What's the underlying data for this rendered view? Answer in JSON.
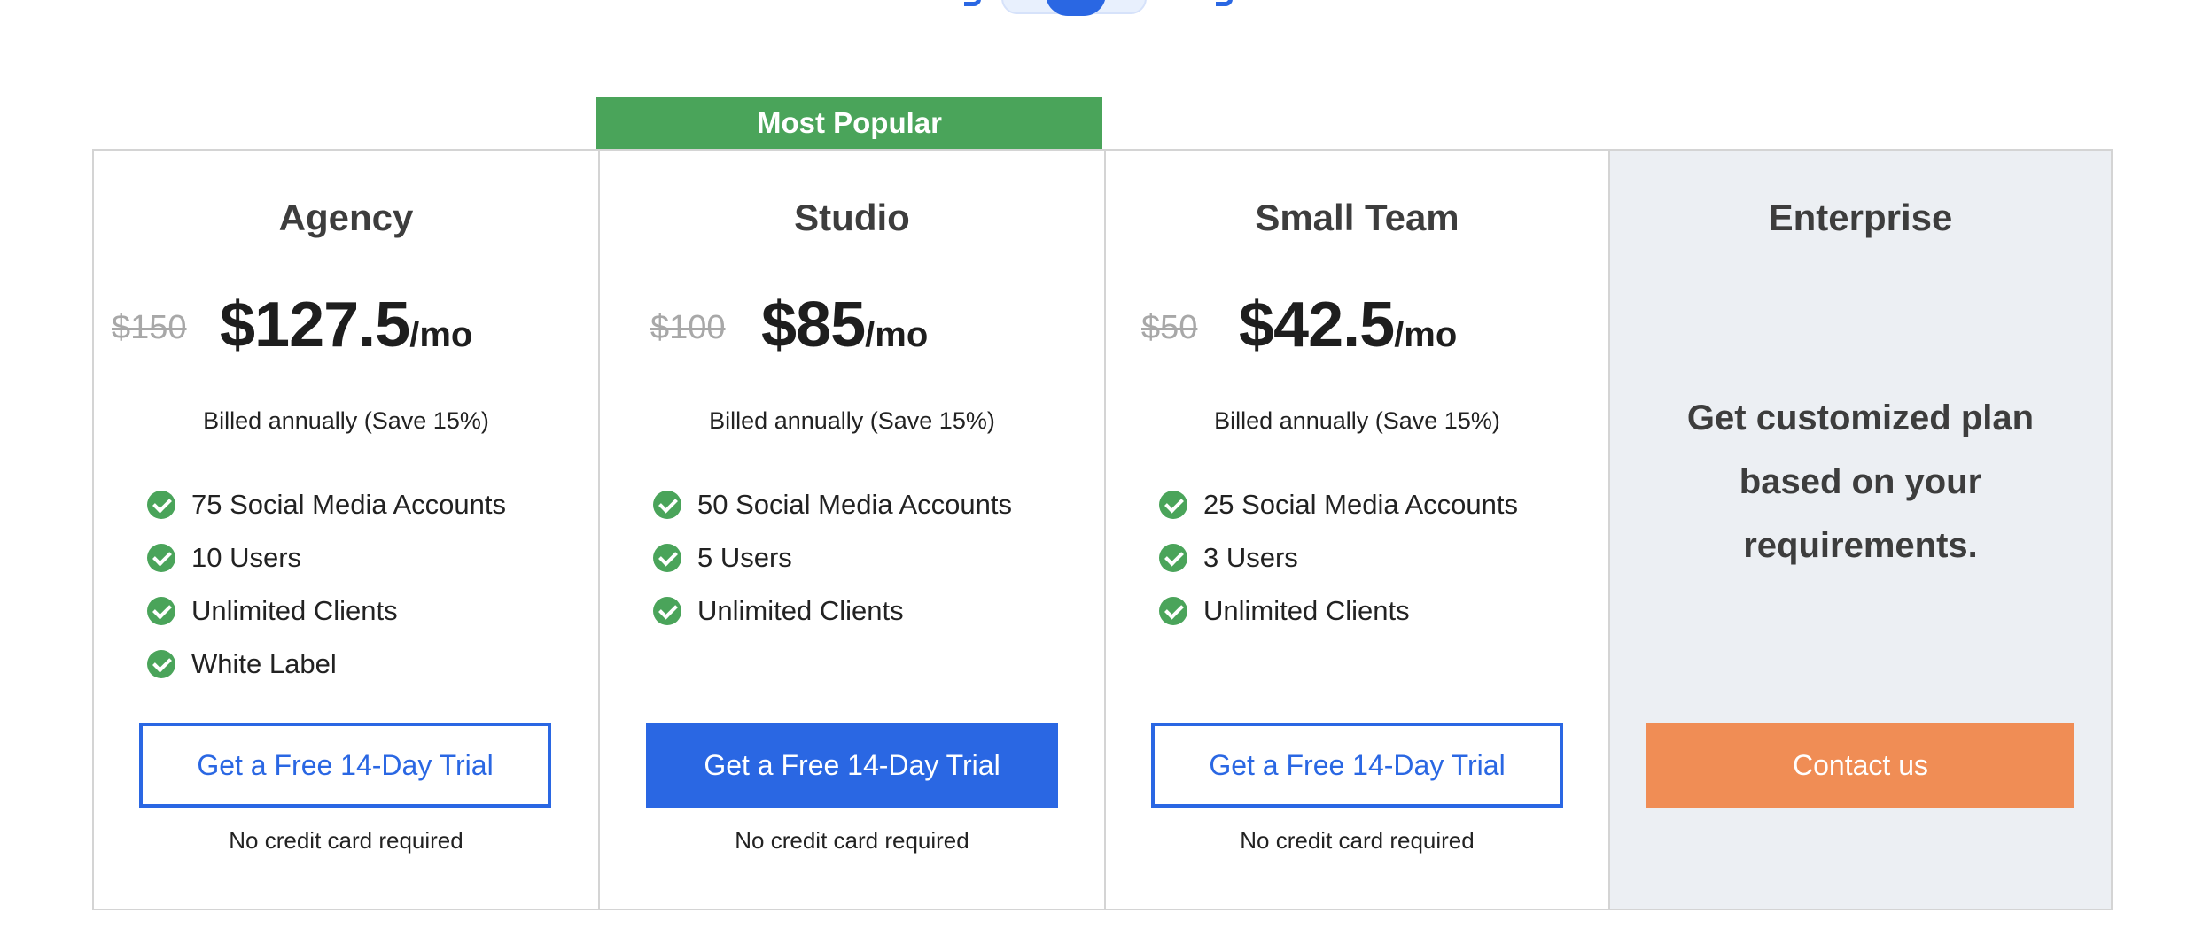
{
  "toggle": {
    "state": "annual"
  },
  "popular_banner": "Most Popular",
  "plans": [
    {
      "name": "Agency",
      "old_price": "$150",
      "price": "$127.5",
      "per": "/mo",
      "billing": "Billed annually (Save 15%)",
      "features": [
        "75 Social Media Accounts",
        "10 Users",
        "Unlimited Clients",
        "White Label"
      ],
      "cta": "Get a Free 14-Day Trial",
      "note": "No credit card required"
    },
    {
      "name": "Studio",
      "old_price": "$100",
      "price": "$85",
      "per": "/mo",
      "billing": "Billed annually (Save 15%)",
      "features": [
        "50 Social Media Accounts",
        "5 Users",
        "Unlimited Clients"
      ],
      "cta": "Get a Free 14-Day Trial",
      "note": "No credit card required"
    },
    {
      "name": "Small Team",
      "old_price": "$50",
      "price": "$42.5",
      "per": "/mo",
      "billing": "Billed annually (Save 15%)",
      "features": [
        "25 Social Media Accounts",
        "3 Users",
        "Unlimited Clients"
      ],
      "cta": "Get a Free 14-Day Trial",
      "note": "No credit card required"
    },
    {
      "name": "Enterprise",
      "description": "Get customized plan based on your requirements.",
      "cta": "Contact us"
    }
  ],
  "colors": {
    "accent_blue": "#2a67e3",
    "popular_green": "#4aa45a",
    "contact_orange": "#f08d55",
    "enterprise_bg": "#eceff3",
    "check_green": "#4aa45a"
  },
  "icons": {
    "feature_check": "check-circle-icon"
  }
}
